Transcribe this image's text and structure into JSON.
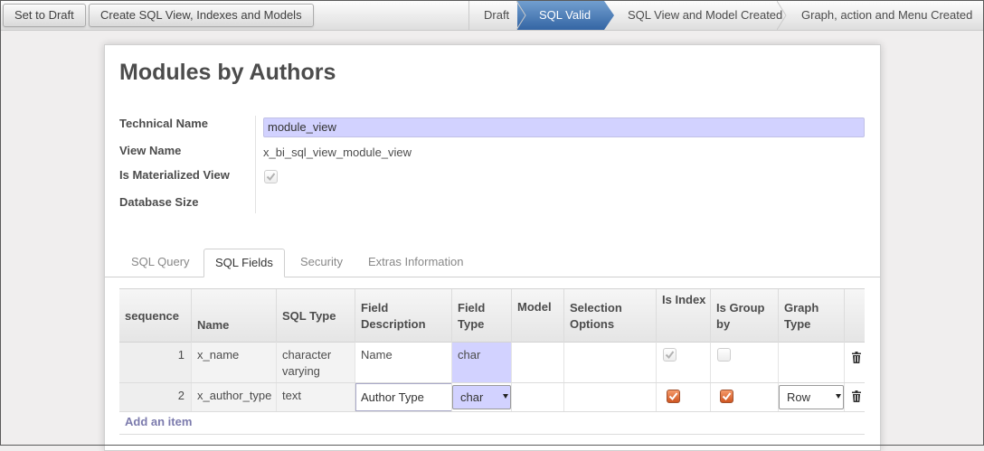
{
  "toolbar": {
    "set_draft_label": "Set to Draft",
    "create_label": "Create SQL View, Indexes and Models"
  },
  "statusbar": {
    "steps": [
      "Draft",
      "SQL Valid",
      "SQL View and Model Created",
      "Graph, action and Menu Created"
    ],
    "active_step": "SQL Valid"
  },
  "form": {
    "title": "Modules by Authors",
    "fields": {
      "technical_name_label": "Technical Name",
      "technical_name_value": "module_view",
      "view_name_label": "View Name",
      "view_name_value": "x_bi_sql_view_module_view",
      "materialized_label": "Is Materialized View",
      "materialized_checked": true,
      "db_size_label": "Database Size"
    }
  },
  "tabs": [
    {
      "label": "SQL Query",
      "active": false
    },
    {
      "label": "SQL Fields",
      "active": true
    },
    {
      "label": "Security",
      "active": false
    },
    {
      "label": "Extras Information",
      "active": false
    }
  ],
  "table": {
    "columns": [
      "sequence",
      "Name",
      "SQL Type",
      "Field Description",
      "Field Type",
      "Model",
      "Selection Options",
      "Is Index",
      "Is Group by",
      "Graph Type"
    ],
    "rows": [
      {
        "sequence": "1",
        "name": "x_name",
        "sql_type": "character varying",
        "description": "Name",
        "field_type": "char",
        "is_index": true,
        "is_group_by": false,
        "graph_type": ""
      },
      {
        "sequence": "2",
        "name": "x_author_type",
        "sql_type": "text",
        "description": "Author Type",
        "field_type": "char",
        "is_index": true,
        "is_group_by": true,
        "graph_type": "Row"
      }
    ],
    "add_item_label": "Add an item"
  },
  "colors": {
    "accent": "#3465a4",
    "required_field": "#d2d2ff",
    "checkbox_on": "#e06a35",
    "link": "#7c7bad"
  },
  "icons": [
    "checkmark-icon",
    "trash-icon",
    "dropdown-caret-icon"
  ]
}
